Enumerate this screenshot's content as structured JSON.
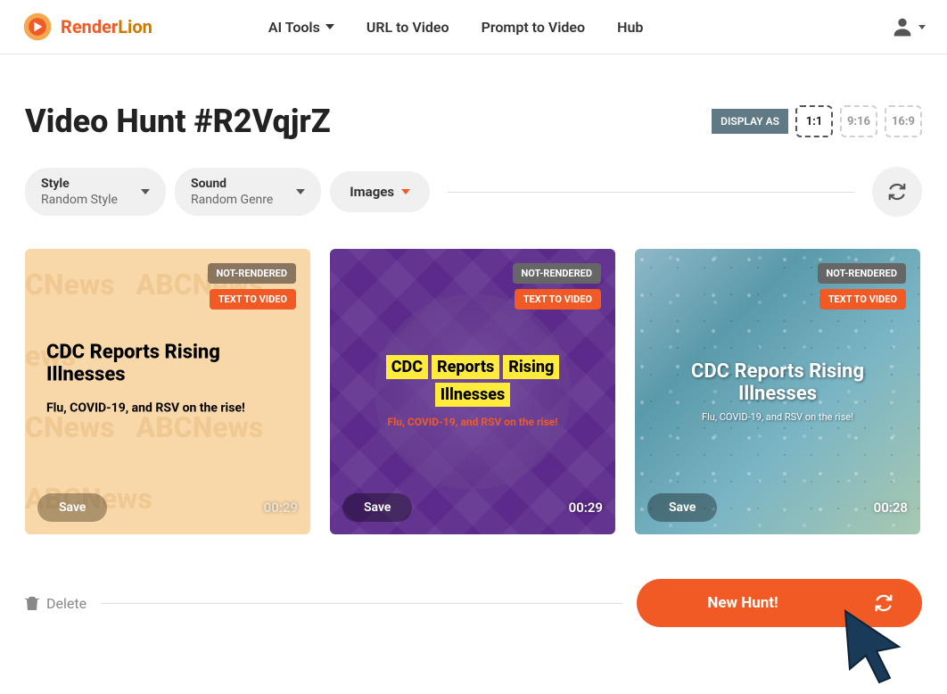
{
  "brand": {
    "render": "Render",
    "lion": "Lion"
  },
  "nav": {
    "ai_tools": "AI Tools",
    "url_to_video": "URL to Video",
    "prompt_to_video": "Prompt to Video",
    "hub": "Hub"
  },
  "page_title": "Video Hunt #R2VqjrZ",
  "display_as": {
    "label": "DISPLAY AS",
    "opt1": "1:1",
    "opt2": "9:16",
    "opt3": "16:9"
  },
  "filters": {
    "style": {
      "label": "Style",
      "value": "Random Style"
    },
    "sound": {
      "label": "Sound",
      "value": "Random Genre"
    },
    "images": "Images"
  },
  "cards": [
    {
      "badge_status": "NOT-RENDERED",
      "badge_type": "TEXT TO VIDEO",
      "title": "CDC Reports Rising Illnesses",
      "subtitle": "Flu, COVID-19, and RSV on the rise!",
      "save": "Save",
      "duration": "00:29",
      "bg_text": "ABCNews"
    },
    {
      "badge_status": "NOT-RENDERED",
      "badge_type": "TEXT TO VIDEO",
      "title_words": {
        "w1": "CDC",
        "w2": "Reports",
        "w3": "Rising",
        "w4": "Illnesses"
      },
      "subtitle": "Flu, COVID-19, and RSV on the rise!",
      "save": "Save",
      "duration": "00:29"
    },
    {
      "badge_status": "NOT-RENDERED",
      "badge_type": "TEXT TO VIDEO",
      "title": "CDC Reports Rising Illnesses",
      "subtitle": "Flu, COVID-19, and RSV on the rise!",
      "save": "Save",
      "duration": "00:28"
    }
  ],
  "footer": {
    "delete": "Delete",
    "new_hunt": "New Hunt!"
  }
}
